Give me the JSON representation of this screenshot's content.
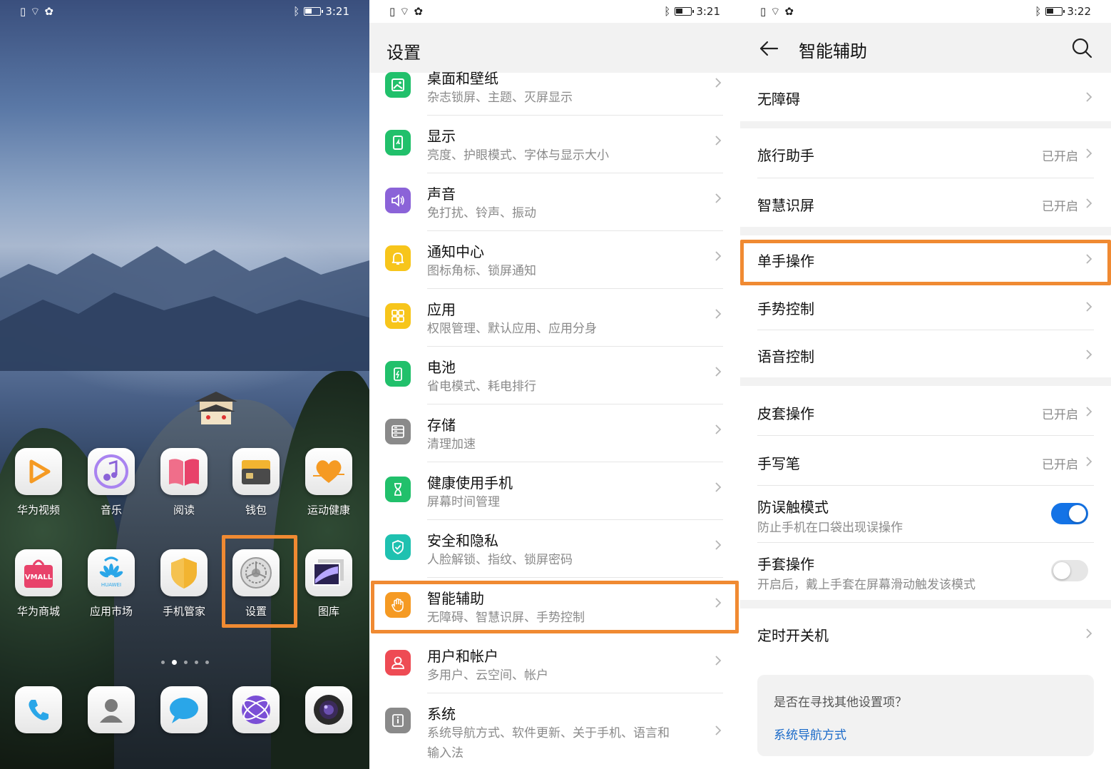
{
  "status_bars": [
    {
      "time": "3:21"
    },
    {
      "time": "3:21"
    },
    {
      "time": "3:22"
    }
  ],
  "home": {
    "apps_row1": [
      {
        "label": "华为视频",
        "icon": "play-icon",
        "color": "#f59a23"
      },
      {
        "label": "音乐",
        "icon": "music-note-icon",
        "color": "#8b63d8"
      },
      {
        "label": "阅读",
        "icon": "book-icon",
        "color": "#e8426a"
      },
      {
        "label": "钱包",
        "icon": "wallet-icon",
        "color": "#f2b431"
      },
      {
        "label": "运动健康",
        "icon": "heart-pulse-icon",
        "color": "#f59a23"
      }
    ],
    "apps_row2": [
      {
        "label": "华为商城",
        "icon": "vmall-bag-icon",
        "color": "#e8426a",
        "badge": "VMALL"
      },
      {
        "label": "应用市场",
        "icon": "huawei-bag-icon",
        "color": "#2aa6e8",
        "badge": "HUAWEI"
      },
      {
        "label": "手机管家",
        "icon": "shield-icon",
        "color": "#f2b431"
      },
      {
        "label": "设置",
        "icon": "gear-icon",
        "color": "#8a8a8a"
      },
      {
        "label": "图库",
        "icon": "photo-icon",
        "color": "#6a5acd"
      }
    ],
    "dock": [
      {
        "icon": "phone-icon",
        "color": "#2aa6e8"
      },
      {
        "icon": "contacts-icon",
        "color": "#7a7a7a"
      },
      {
        "icon": "message-icon",
        "color": "#2aa6e8"
      },
      {
        "icon": "browser-icon",
        "color": "#7b4fd6"
      },
      {
        "icon": "camera-icon",
        "color": "#333333"
      }
    ]
  },
  "settings": {
    "title": "设置",
    "items": [
      {
        "title": "桌面和壁纸",
        "subtitle": "杂志锁屏、主题、灭屏显示",
        "icon": "wallpaper-icon",
        "color": "#21c06b"
      },
      {
        "title": "显示",
        "subtitle": "亮度、护眼模式、字体与显示大小",
        "icon": "display-icon",
        "color": "#21c06b"
      },
      {
        "title": "声音",
        "subtitle": "免打扰、铃声、振动",
        "icon": "speaker-icon",
        "color": "#8b63d8"
      },
      {
        "title": "通知中心",
        "subtitle": "图标角标、锁屏通知",
        "icon": "bell-icon",
        "color": "#f7c51b"
      },
      {
        "title": "应用",
        "subtitle": "权限管理、默认应用、应用分身",
        "icon": "apps-grid-icon",
        "color": "#f7c51b"
      },
      {
        "title": "电池",
        "subtitle": "省电模式、耗电排行",
        "icon": "battery-icon",
        "color": "#21c06b"
      },
      {
        "title": "存储",
        "subtitle": "清理加速",
        "icon": "storage-icon",
        "color": "#8a8a8a"
      },
      {
        "title": "健康使用手机",
        "subtitle": "屏幕时间管理",
        "icon": "hourglass-icon",
        "color": "#21c06b"
      },
      {
        "title": "安全和隐私",
        "subtitle": "人脸解锁、指纹、锁屏密码",
        "icon": "shield-check-icon",
        "color": "#1fc1b0"
      },
      {
        "title": "智能辅助",
        "subtitle": "无障碍、智慧识屏、手势控制",
        "icon": "hand-icon",
        "color": "#f59a23"
      },
      {
        "title": "用户和帐户",
        "subtitle": "多用户、云空间、帐户",
        "icon": "user-icon",
        "color": "#ee4b54"
      },
      {
        "title": "系统",
        "subtitle": "系统导航方式、软件更新、关于手机、语言和",
        "subtitle2": "输入法",
        "icon": "info-icon",
        "color": "#8a8a8a"
      }
    ]
  },
  "assist": {
    "title": "智能辅助",
    "items": [
      {
        "title": "无障碍"
      },
      {
        "title": "旅行助手",
        "status": "已开启"
      },
      {
        "title": "智慧识屏",
        "status": "已开启"
      },
      {
        "title": "单手操作"
      },
      {
        "title": "手势控制"
      },
      {
        "title": "语音控制"
      },
      {
        "title": "皮套操作",
        "status": "已开启"
      },
      {
        "title": "手写笔",
        "status": "已开启"
      },
      {
        "title": "防误触模式",
        "subtitle": "防止手机在口袋出现误操作",
        "toggle": "on"
      },
      {
        "title": "手套操作",
        "subtitle": "开启后，戴上手套在屏幕滑动触发该模式",
        "toggle": "off"
      },
      {
        "title": "定时开关机"
      }
    ],
    "suggest": {
      "question": "是否在寻找其他设置项？",
      "link": "系统导航方式"
    }
  },
  "highlight_color": "#f08a32"
}
